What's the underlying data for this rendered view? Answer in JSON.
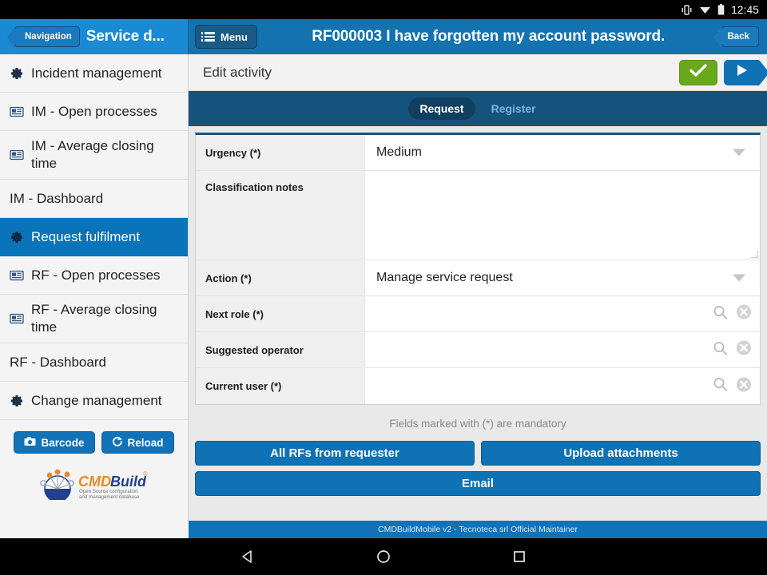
{
  "statusbar": {
    "time": "12:45",
    "icons": [
      "vibrate-icon",
      "wifi-icon",
      "battery-icon"
    ]
  },
  "header": {
    "navigation_label": "Navigation",
    "app_title": "Service d...",
    "menu_label": "Menu",
    "record_title": "RF000003 I have forgotten my account password.",
    "back_label": "Back"
  },
  "sidebar": {
    "items": [
      {
        "label": "Incident management",
        "icon": "gear-icon",
        "active": false
      },
      {
        "label": "IM - Open processes",
        "icon": "report-icon",
        "active": false
      },
      {
        "label": "IM - Average closing time",
        "icon": "report-icon",
        "active": false
      },
      {
        "label": "IM - Dashboard",
        "icon": "none",
        "active": false
      },
      {
        "label": "Request fulfilment",
        "icon": "gear-icon",
        "active": true
      },
      {
        "label": "RF - Open processes",
        "icon": "report-icon",
        "active": false
      },
      {
        "label": "RF - Average closing time",
        "icon": "report-icon",
        "active": false
      },
      {
        "label": "RF - Dashboard",
        "icon": "none",
        "active": false
      },
      {
        "label": "Change management",
        "icon": "gear-icon",
        "active": false
      }
    ],
    "barcode_label": "Barcode",
    "reload_label": "Reload",
    "logo": {
      "part1": "CMD",
      "part2": "Build",
      "tagline_line1": "Open Source configuration",
      "tagline_line2": "and management database"
    }
  },
  "content": {
    "edit_title": "Edit activity",
    "confirm_icon": "check-icon",
    "forward_icon": "play-icon",
    "tabs": [
      {
        "label": "Request",
        "active": true
      },
      {
        "label": "Register",
        "active": false
      }
    ],
    "fields": [
      {
        "label": "Urgency (*)",
        "value": "Medium",
        "type": "select"
      },
      {
        "label": "Classification notes",
        "value": "",
        "type": "textarea"
      },
      {
        "label": "Action (*)",
        "value": "Manage service request",
        "type": "select"
      },
      {
        "label": "Next role (*)",
        "value": "",
        "type": "lookup"
      },
      {
        "label": "Suggested operator",
        "value": "",
        "type": "lookup"
      },
      {
        "label": "Current user (*)",
        "value": "",
        "type": "lookup"
      }
    ],
    "mandatory_note": "Fields marked with (*) are mandatory",
    "buttons": {
      "all_rfs": "All RFs from requester",
      "upload": "Upload attachments",
      "email": "Email"
    }
  },
  "footer": {
    "text": "CMDBuildMobile v2 - Tecnoteca srl Official Maintainer"
  },
  "navbar": {
    "back_icon": "triangle-back-icon",
    "home_icon": "circle-home-icon",
    "recents_icon": "square-recents-icon"
  },
  "colors": {
    "brand_blue": "#1272b8",
    "header_blue": "#1273b0",
    "tabbar_blue": "#15537d",
    "active_item": "#0a74ba",
    "confirm_green": "#6aa81b",
    "logo_orange": "#e8892a",
    "logo_blue": "#2a4b9b"
  }
}
